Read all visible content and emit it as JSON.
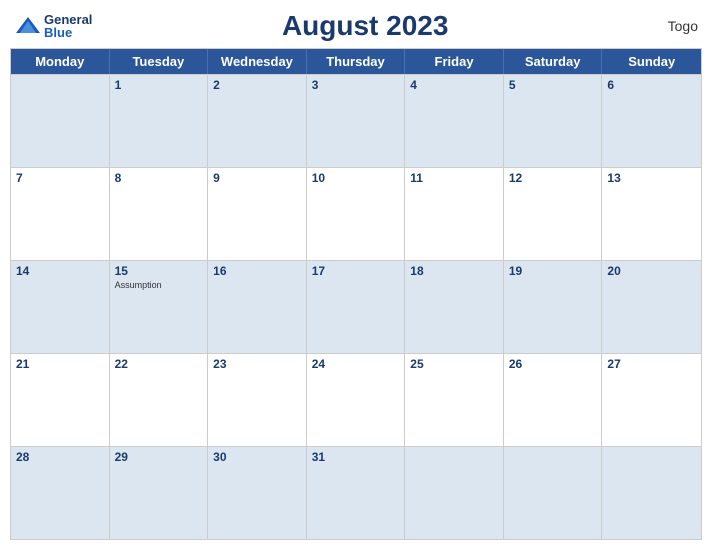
{
  "header": {
    "logo_general": "General",
    "logo_blue": "Blue",
    "title": "August 2023",
    "country": "Togo"
  },
  "day_headers": [
    "Monday",
    "Tuesday",
    "Wednesday",
    "Thursday",
    "Friday",
    "Saturday",
    "Sunday"
  ],
  "weeks": [
    [
      {
        "date": "",
        "holiday": ""
      },
      {
        "date": "1",
        "holiday": ""
      },
      {
        "date": "2",
        "holiday": ""
      },
      {
        "date": "3",
        "holiday": ""
      },
      {
        "date": "4",
        "holiday": ""
      },
      {
        "date": "5",
        "holiday": ""
      },
      {
        "date": "6",
        "holiday": ""
      }
    ],
    [
      {
        "date": "7",
        "holiday": ""
      },
      {
        "date": "8",
        "holiday": ""
      },
      {
        "date": "9",
        "holiday": ""
      },
      {
        "date": "10",
        "holiday": ""
      },
      {
        "date": "11",
        "holiday": ""
      },
      {
        "date": "12",
        "holiday": ""
      },
      {
        "date": "13",
        "holiday": ""
      }
    ],
    [
      {
        "date": "14",
        "holiday": ""
      },
      {
        "date": "15",
        "holiday": "Assumption"
      },
      {
        "date": "16",
        "holiday": ""
      },
      {
        "date": "17",
        "holiday": ""
      },
      {
        "date": "18",
        "holiday": ""
      },
      {
        "date": "19",
        "holiday": ""
      },
      {
        "date": "20",
        "holiday": ""
      }
    ],
    [
      {
        "date": "21",
        "holiday": ""
      },
      {
        "date": "22",
        "holiday": ""
      },
      {
        "date": "23",
        "holiday": ""
      },
      {
        "date": "24",
        "holiday": ""
      },
      {
        "date": "25",
        "holiday": ""
      },
      {
        "date": "26",
        "holiday": ""
      },
      {
        "date": "27",
        "holiday": ""
      }
    ],
    [
      {
        "date": "28",
        "holiday": ""
      },
      {
        "date": "29",
        "holiday": ""
      },
      {
        "date": "30",
        "holiday": ""
      },
      {
        "date": "31",
        "holiday": ""
      },
      {
        "date": "",
        "holiday": ""
      },
      {
        "date": "",
        "holiday": ""
      },
      {
        "date": "",
        "holiday": ""
      }
    ]
  ]
}
